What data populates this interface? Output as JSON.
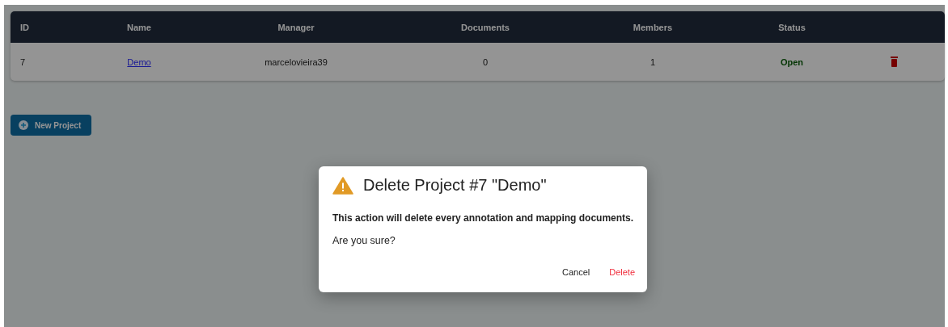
{
  "table": {
    "columns": [
      "ID",
      "Name",
      "Manager",
      "Documents",
      "Members",
      "Status"
    ],
    "rows": [
      {
        "id": "7",
        "name": "Demo",
        "manager": "marcelovieira39",
        "documents": "0",
        "members": "1",
        "status": "Open"
      }
    ]
  },
  "new_project_button": {
    "label": "New Project"
  },
  "dialog": {
    "title": "Delete Project #7 \"Demo\"",
    "message": "This action will delete every annotation and mapping documents.",
    "question": "Are you sure?",
    "buttons": [
      {
        "label": "Cancel",
        "kind": "neutral"
      },
      {
        "label": "Delete",
        "kind": "danger"
      }
    ]
  }
}
